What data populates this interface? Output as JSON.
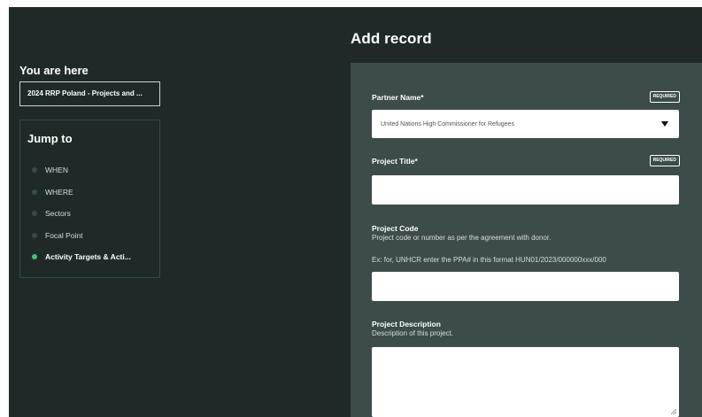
{
  "header": {
    "title": "Add record"
  },
  "navigation": {
    "you_are_here_label": "You are here",
    "breadcrumb": "2024 RRP Poland - Projects and ...",
    "jump_to_label": "Jump to",
    "items": [
      {
        "label": "WHEN",
        "active": false
      },
      {
        "label": "WHERE",
        "active": false
      },
      {
        "label": "Sectors",
        "active": false
      },
      {
        "label": "Focal Point",
        "active": false
      },
      {
        "label": "Activity Targets & Acti...",
        "active": true
      }
    ]
  },
  "form": {
    "partner_name": {
      "label": "Partner Name*",
      "badge": "REQUIRED",
      "value": "United Nations High Commissioner for Refugees"
    },
    "project_title": {
      "label": "Project Title*",
      "badge": "REQUIRED",
      "value": ""
    },
    "project_code": {
      "label": "Project Code",
      "description": "Project code or number as per the agreement with donor.",
      "example": "Ex: for, UNHCR enter the PPA# in this format HUN01/2023/000000xxx/000",
      "value": ""
    },
    "project_description": {
      "label": "Project Description",
      "description": "Description of this project.",
      "value": ""
    }
  },
  "colors": {
    "background": "#1f2a28",
    "form_panel": "#3b4c4a",
    "active_dot": "#3ec27a"
  }
}
